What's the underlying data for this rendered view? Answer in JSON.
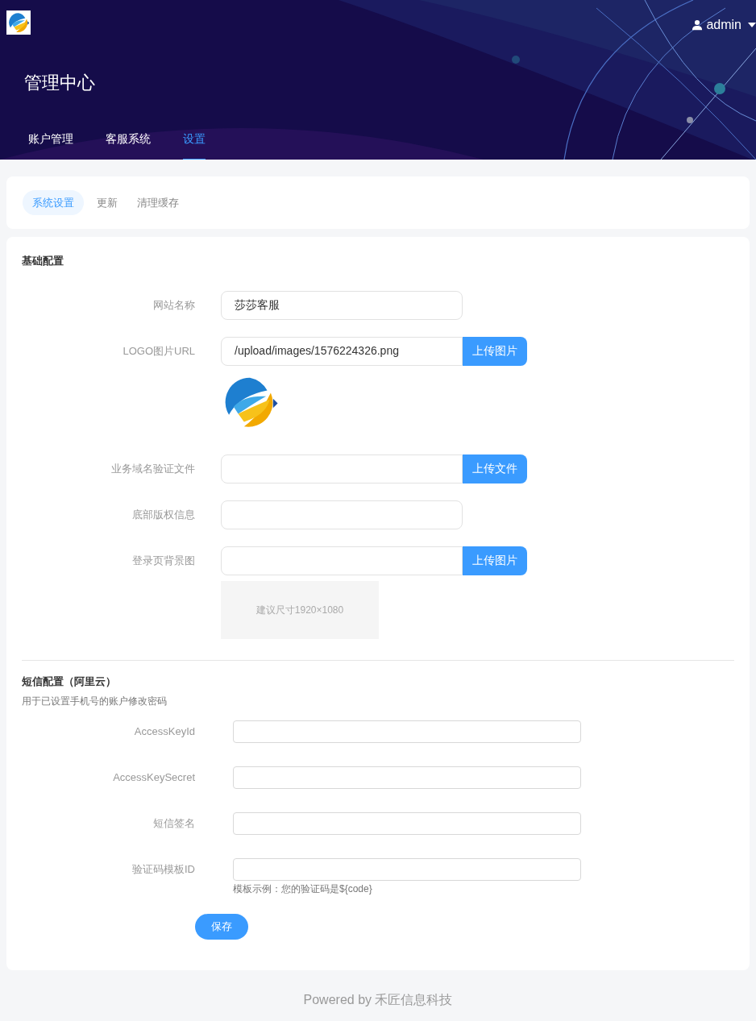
{
  "header": {
    "user": "admin",
    "title": "管理中心",
    "nav": [
      {
        "label": "账户管理",
        "selected": false
      },
      {
        "label": "客服系统",
        "selected": false
      },
      {
        "label": "设置",
        "selected": true
      }
    ]
  },
  "subtabs": [
    {
      "label": "系统设置",
      "selected": true
    },
    {
      "label": "更新",
      "selected": false
    },
    {
      "label": "清理缓存",
      "selected": false
    }
  ],
  "basic": {
    "title": "基础配置",
    "fields": [
      {
        "kind": "text",
        "label": "网站名称",
        "value": "莎莎客服"
      },
      {
        "kind": "upload",
        "label": "LOGO图片URL",
        "value": "/upload/images/1576224326.png",
        "button": "上传图片",
        "preview": {
          "kind": "logo"
        }
      },
      {
        "kind": "upload",
        "label": "业务域名验证文件",
        "button": "上传文件"
      },
      {
        "kind": "text",
        "label": "底部版权信息"
      },
      {
        "kind": "upload",
        "label": "登录页背景图",
        "button": "上传图片",
        "preview": {
          "kind": "hint",
          "text": "建议尺寸1920×1080"
        }
      }
    ]
  },
  "sms": {
    "title": "短信配置（阿里云）",
    "subtitle": "用于已设置手机号的账户修改密码",
    "fields": [
      {
        "label": "AccessKeyId"
      },
      {
        "label": "AccessKeySecret"
      },
      {
        "label": "短信签名"
      },
      {
        "label": "验证码模板ID",
        "help": "模板示例：您的验证码是${code}"
      }
    ]
  },
  "save_button": "保存",
  "footer": "Powered by 禾匠信息科技"
}
